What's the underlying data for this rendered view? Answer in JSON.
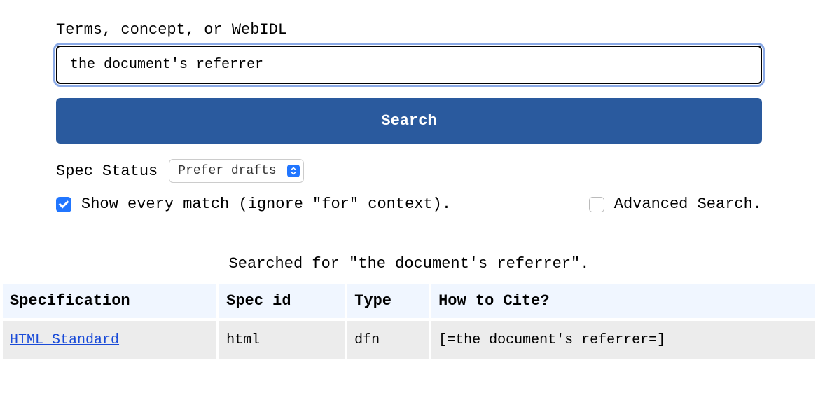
{
  "form": {
    "label": "Terms, concept, or WebIDL",
    "search_value": "the document's referrer",
    "search_button": "Search",
    "status_label": "Spec Status",
    "status_selected": "Prefer drafts",
    "show_every_label": "Show every match (ignore \"for\" context).",
    "advanced_label": "Advanced Search."
  },
  "results": {
    "caption": "Searched for \"the document's referrer\".",
    "headers": {
      "spec": "Specification",
      "spec_id": "Spec id",
      "type": "Type",
      "cite": "How to Cite?"
    },
    "rows": [
      {
        "spec": "HTML Standard",
        "spec_id": "html",
        "type": "dfn",
        "cite": "[=the document's referrer=]"
      }
    ]
  }
}
